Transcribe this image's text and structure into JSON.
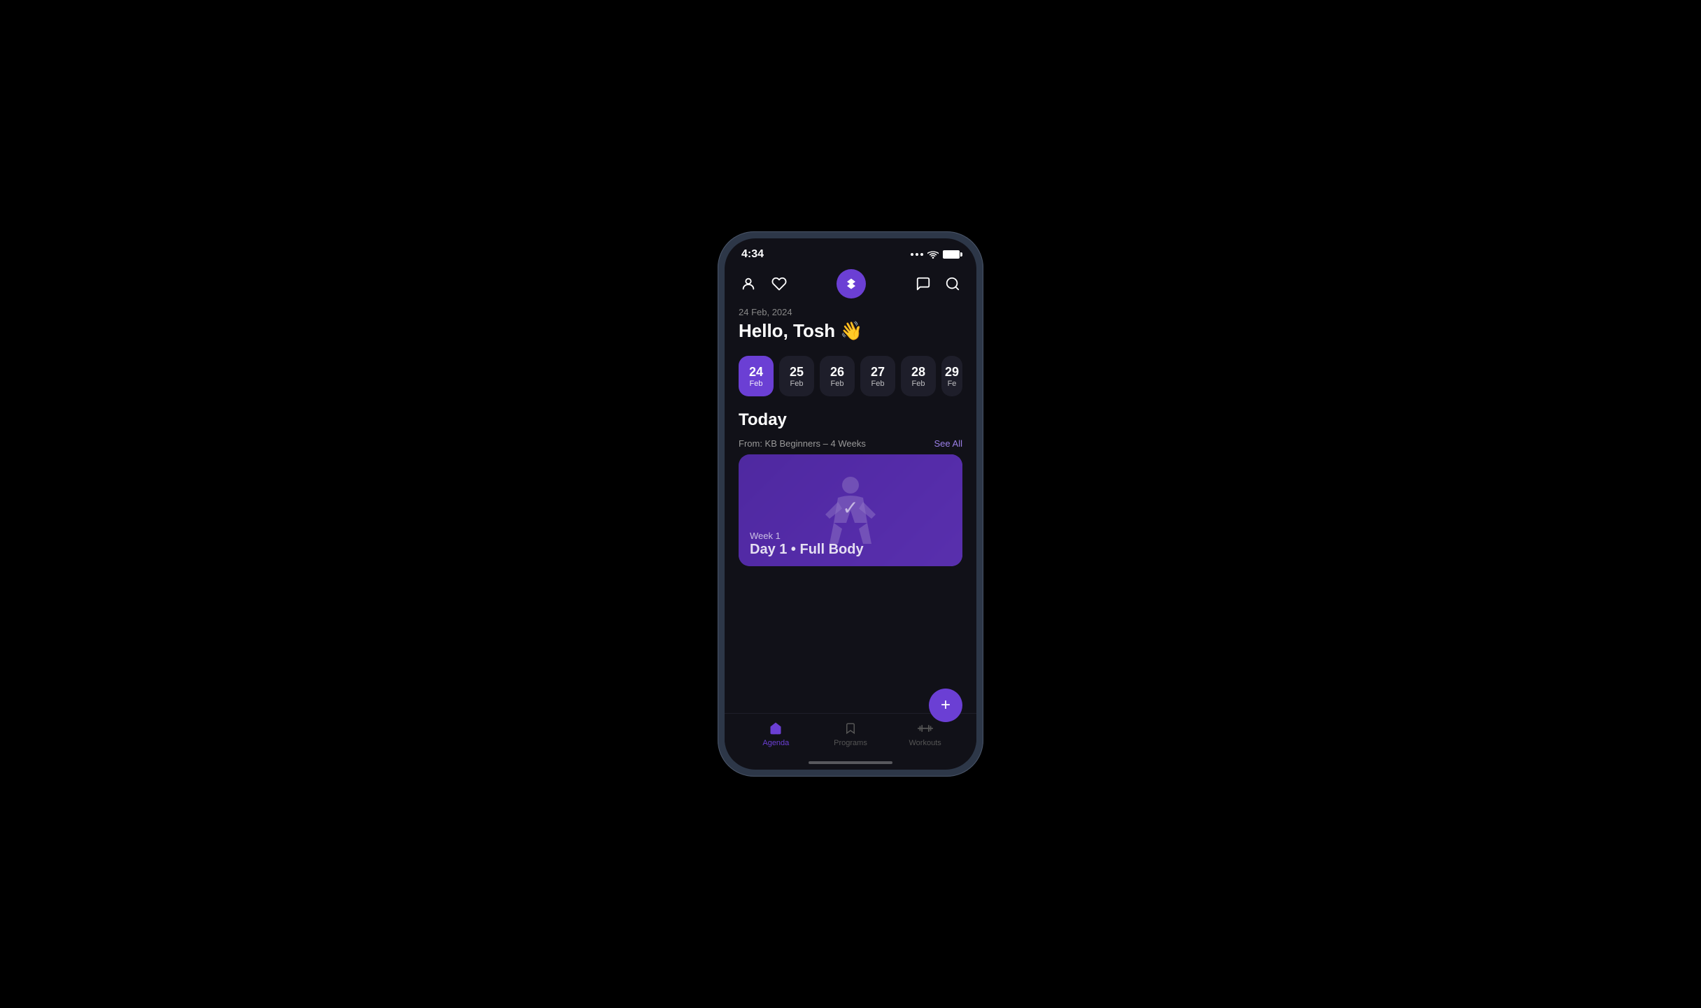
{
  "device": {
    "time": "4:34",
    "bg": "#111118"
  },
  "header": {
    "date_label": "24 Feb, 2024",
    "greeting": "Hello, Tosh 👋",
    "logo_icon": "▼"
  },
  "date_strip": {
    "dates": [
      {
        "num": "24",
        "month": "Feb",
        "active": true
      },
      {
        "num": "25",
        "month": "Feb",
        "active": false
      },
      {
        "num": "26",
        "month": "Feb",
        "active": false
      },
      {
        "num": "27",
        "month": "Feb",
        "active": false
      },
      {
        "num": "28",
        "month": "Feb",
        "active": false
      },
      {
        "num": "29",
        "month": "Fe",
        "active": false,
        "partial": true
      }
    ]
  },
  "today_section": {
    "title": "Today",
    "from_label": "From: KB Beginners – 4 Weeks",
    "see_all": "See All",
    "workout_card": {
      "week": "Week 1",
      "title": "Day 1 • Full Body"
    }
  },
  "fab": {
    "label": "+"
  },
  "bottom_nav": {
    "tabs": [
      {
        "label": "Agenda",
        "active": true,
        "icon": "house"
      },
      {
        "label": "Programs",
        "active": false,
        "icon": "bookmark"
      },
      {
        "label": "Workouts",
        "active": false,
        "icon": "dumbbell"
      }
    ]
  }
}
